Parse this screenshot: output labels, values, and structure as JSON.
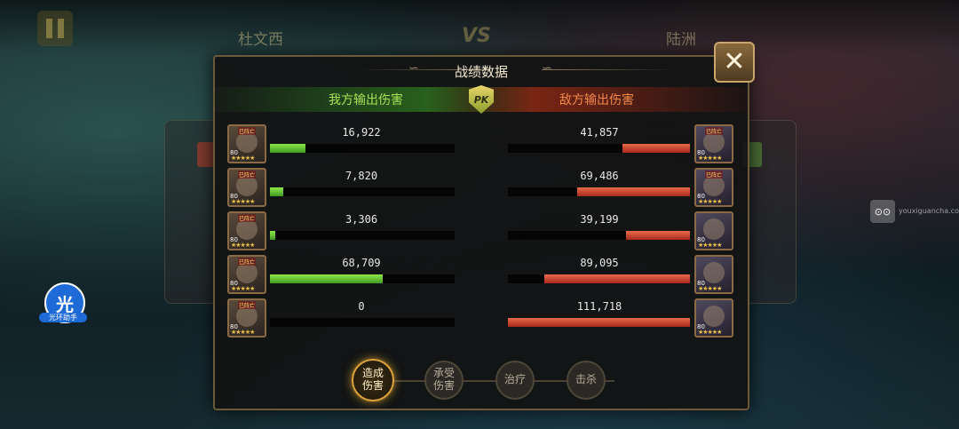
{
  "background": {
    "left_player_name": "杜文西",
    "vs_label": "VS",
    "right_player_name": "陆洲"
  },
  "dialog": {
    "title": "战绩数据",
    "left_header": "我方输出伤害",
    "right_header": "敌方输出伤害",
    "pk_label": "PK",
    "close_label": "✕"
  },
  "ally_rows": [
    {
      "value_text": "16,922",
      "fill": 0.19,
      "level": "80",
      "tag": "已阵亡",
      "stars": "★★★★★"
    },
    {
      "value_text": "7,820",
      "fill": 0.07,
      "level": "80",
      "tag": "已阵亡",
      "stars": "★★★★★"
    },
    {
      "value_text": "3,306",
      "fill": 0.03,
      "level": "80",
      "tag": "已阵亡",
      "stars": "★★★★★"
    },
    {
      "value_text": "68,709",
      "fill": 0.61,
      "level": "80",
      "tag": "已阵亡",
      "stars": "★★★★★"
    },
    {
      "value_text": "0",
      "fill": 0.0,
      "level": "80",
      "tag": "已阵亡",
      "stars": "★★★★★"
    }
  ],
  "enemy_rows": [
    {
      "value_text": "41,857",
      "fill": 0.37,
      "level": "80",
      "tag": "已阵亡",
      "stars": "★★★★★"
    },
    {
      "value_text": "69,486",
      "fill": 0.62,
      "level": "80",
      "tag": "已阵亡",
      "stars": "★★★★★"
    },
    {
      "value_text": "39,199",
      "fill": 0.35,
      "level": "80",
      "tag": "",
      "stars": "★★★★★"
    },
    {
      "value_text": "89,095",
      "fill": 0.8,
      "level": "80",
      "tag": "",
      "stars": "★★★★★"
    },
    {
      "value_text": "111,718",
      "fill": 1.0,
      "level": "80",
      "tag": "",
      "stars": "★★★★★"
    }
  ],
  "tabs": [
    {
      "label": "造成\n伤害",
      "active": true
    },
    {
      "label": "承受\n伤害",
      "active": false
    },
    {
      "label": "治疗",
      "active": false
    },
    {
      "label": "击杀",
      "active": false
    }
  ],
  "overlay": {
    "helper_icon": "光",
    "helper_label": "光环助手",
    "watermark_icon": "⊙⊙",
    "watermark_text": "youxiguancha.com"
  },
  "colors": {
    "ally_bar": "#5fc236",
    "enemy_bar": "#c8402a",
    "active_tab_glow": "#d9a23c"
  }
}
